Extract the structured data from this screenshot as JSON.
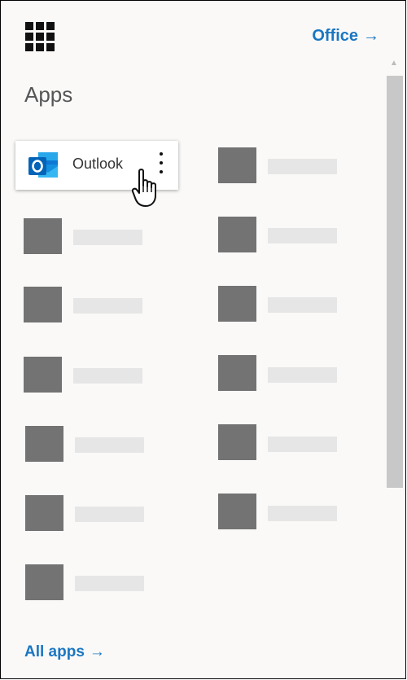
{
  "header": {
    "office_link_label": "Office",
    "office_link_arrow": "→"
  },
  "apps_section": {
    "title": "Apps"
  },
  "featured_app": {
    "name": "Outlook",
    "icon": "outlook-icon"
  },
  "placeholder_apps": {
    "left_column_count": 6,
    "right_column_count": 6
  },
  "footer": {
    "all_apps_label": "All apps",
    "all_apps_arrow": "→"
  },
  "colors": {
    "link": "#1b76c2",
    "tile": "#737373",
    "label_bar": "#e6e6e6",
    "background": "#faf9f8"
  }
}
